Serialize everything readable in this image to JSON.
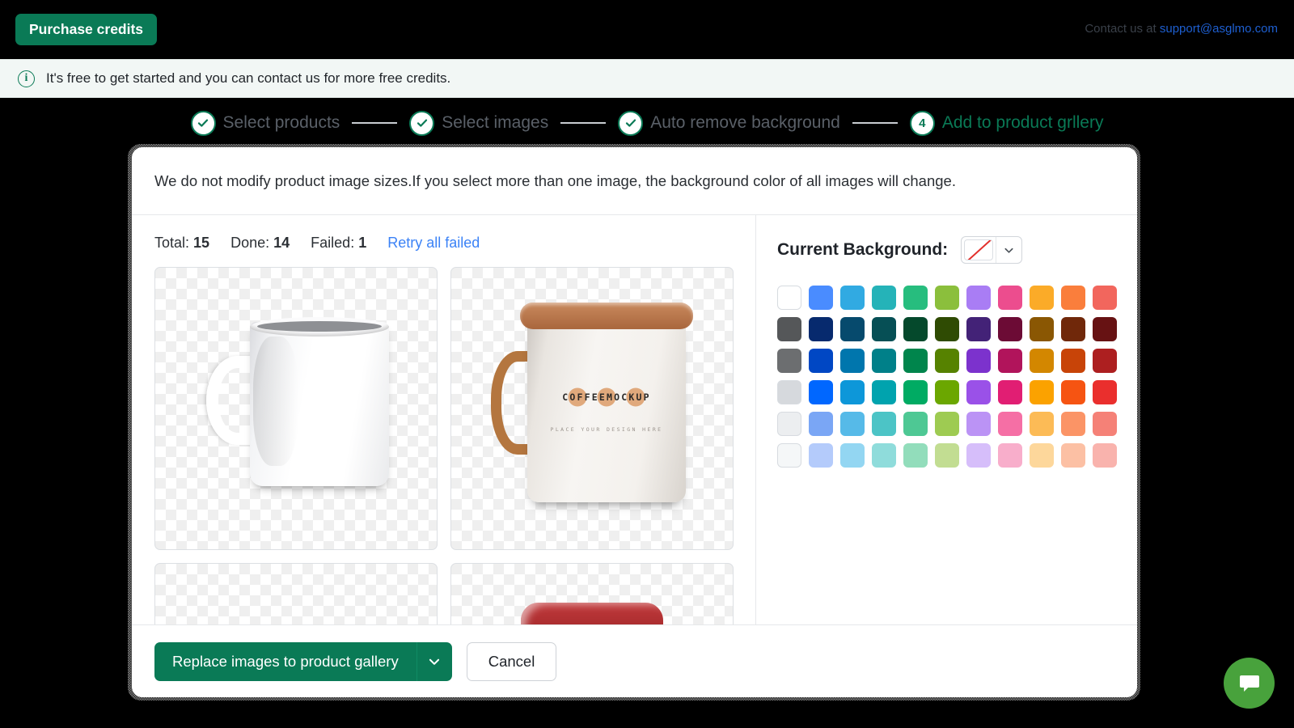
{
  "topbar": {
    "purchase_label": "Purchase credits",
    "contact_prefix": "Contact us at ",
    "contact_email": "support@asglmo.com"
  },
  "banner": {
    "icon": "info-icon",
    "glyph": "i",
    "text": "It's free to get started and you can contact us for more free credits."
  },
  "stepper": {
    "steps": [
      {
        "label": "Select products",
        "marker": "check",
        "state": "done"
      },
      {
        "label": "Select images",
        "marker": "check",
        "state": "done"
      },
      {
        "label": "Auto remove background",
        "marker": "check",
        "state": "done"
      },
      {
        "label": "Add to product grllery",
        "marker": "4",
        "state": "current"
      }
    ]
  },
  "modal": {
    "notice": "We do not modify product image sizes.If you select more than one image, the background color of all images will change.",
    "counts": {
      "total_label": "Total:",
      "total_value": "15",
      "done_label": "Done:",
      "done_value": "14",
      "failed_label": "Failed:",
      "failed_value": "1",
      "retry_label": "Retry all failed"
    },
    "thumbnails": [
      {
        "name": "white-mug",
        "alt": "Plain white ceramic mug on transparent background"
      },
      {
        "name": "enamel-mug",
        "alt": "Enamel mug mockup",
        "logo_word": "COFFEEMOCKUP",
        "logo_tm": "•",
        "logo_sub": "PLACE YOUR DESIGN HERE"
      },
      {
        "name": "empty-thumb",
        "alt": "Transparent placeholder"
      },
      {
        "name": "red-mug",
        "alt": "Red mug top rim"
      }
    ],
    "background": {
      "label": "Current Background:",
      "selected": "none",
      "selected_swatch": "transparent-slash",
      "slash_color": "#e2302c",
      "caret_icon": "chevron-down-icon"
    },
    "palette": {
      "columns": 11,
      "rows": [
        [
          "#ffffff",
          "#4a8cff",
          "#31aae2",
          "#25b3b8",
          "#27bd7e",
          "#8bbf3c",
          "#a97df4",
          "#ec4d8e",
          "#fbab28",
          "#fa7e3c",
          "#f2665d"
        ],
        [
          "#555759",
          "#072a6e",
          "#064a6d",
          "#064f55",
          "#05492c",
          "#2f4b03",
          "#432277",
          "#6c0b35",
          "#8a5703",
          "#70280a",
          "#671213"
        ],
        [
          "#6c6e70",
          "#0047c4",
          "#0076ad",
          "#008089",
          "#00854c",
          "#568200",
          "#7c32cd",
          "#b1145b",
          "#d38700",
          "#c84408",
          "#ad1f20"
        ],
        [
          "#d6d9dd",
          "#0067ff",
          "#0d97d9",
          "#00a3ae",
          "#00ab63",
          "#6ba700",
          "#9a51e8",
          "#e11e73",
          "#fba200",
          "#f65412",
          "#ea2f2d"
        ],
        [
          "#eceef0",
          "#7aa6f5",
          "#56bae8",
          "#4cc4c6",
          "#4ec894",
          "#9ecb52",
          "#bb93f5",
          "#f56fa5",
          "#fcbb56",
          "#fb9466",
          "#f58177"
        ],
        [
          "#f5f7f8",
          "#b4cbfb",
          "#93d6f2",
          "#8fdcdb",
          "#92ddbb",
          "#c2dd92",
          "#d6befa",
          "#f8aecb",
          "#fdd79b",
          "#fcc0a4",
          "#f9b3ad"
        ]
      ]
    },
    "footer": {
      "primary_label": "Replace images to product gallery",
      "primary_caret": "chevron-down-icon",
      "cancel_label": "Cancel"
    }
  },
  "chat": {
    "icon": "chat-bubble-icon",
    "color": "#48a23c"
  }
}
